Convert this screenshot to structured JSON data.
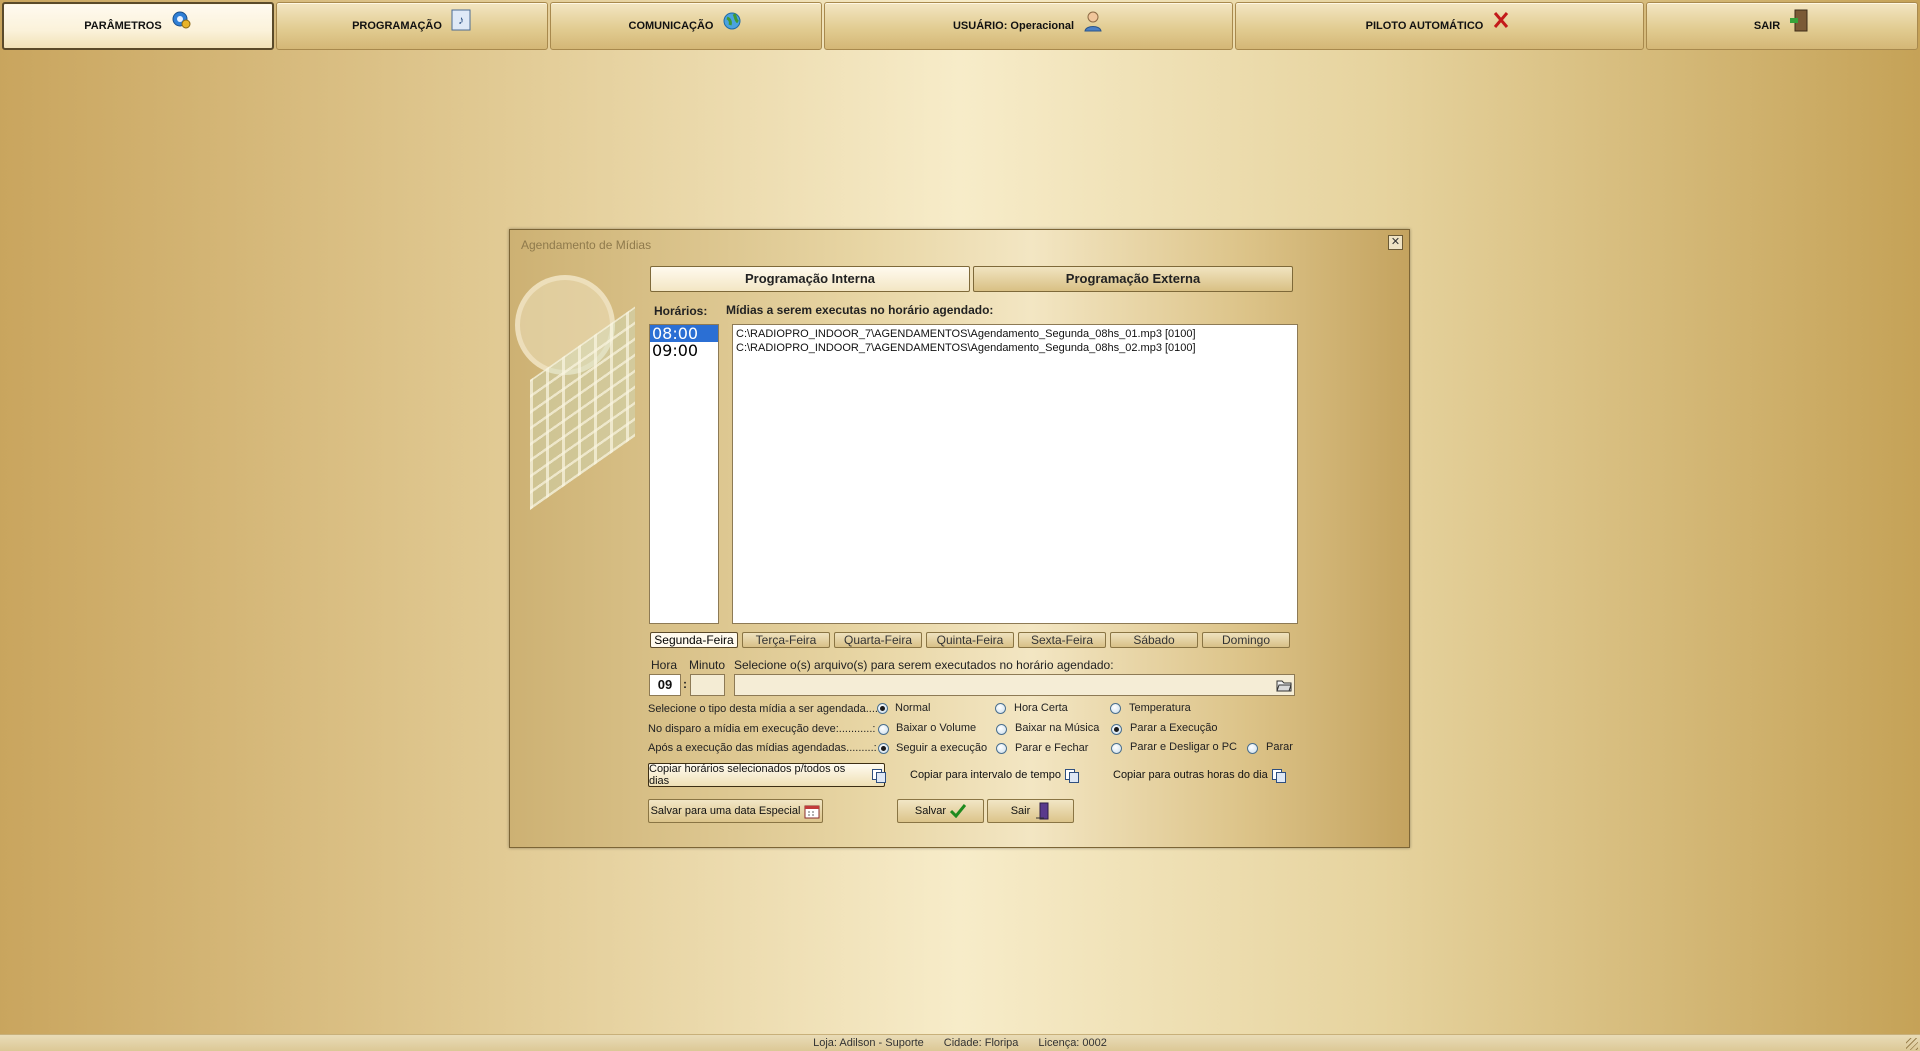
{
  "topmenu": {
    "parametros": "PARÂMETROS",
    "programacao": "PROGRAMAÇÃO",
    "comunicacao": "COMUNICAÇÃO",
    "usuario": "USUÁRIO: Operacional",
    "piloto": "PILOTO AUTOMÁTICO",
    "sair": "SAIR"
  },
  "dialog": {
    "title": "Agendamento de Mídias",
    "close_symbol": "✕",
    "tabs": {
      "interna": "Programação Interna",
      "externa": "Programação Externa"
    },
    "horarios_label": "Horários:",
    "midias_label": "Mídias a serem executas no horário agendado:",
    "hours": [
      "08:00",
      "09:00"
    ],
    "media": [
      "C:\\RADIOPRO_INDOOR_7\\AGENDAMENTOS\\Agendamento_Segunda_08hs_01.mp3 [0100]",
      "C:\\RADIOPRO_INDOOR_7\\AGENDAMENTOS\\Agendamento_Segunda_08hs_02.mp3 [0100]"
    ],
    "days": [
      "Segunda-Feira",
      "Terça-Feira",
      "Quarta-Feira",
      "Quinta-Feira",
      "Sexta-Feira",
      "Sábado",
      "Domingo"
    ],
    "hora_label": "Hora",
    "minuto_label": "Minuto",
    "hora_value": "09",
    "minuto_value": "",
    "time_sep": ":",
    "file_label": "Selecione o(s) arquivo(s) para serem executados no horário agendado:",
    "file_value": "",
    "row1_label": "Selecione o tipo desta mídia a ser agendada....:",
    "row1_opts": [
      "Normal",
      "Hora Certa",
      "Temperatura"
    ],
    "row2_label": "No disparo a mídia em execução deve:...........:",
    "row2_opts": [
      "Baixar o Volume",
      "Baixar na Música",
      "Parar a Execução"
    ],
    "row3_label": "Após a execução das mídias agendadas.........:",
    "row3_opts": [
      "Seguir a execução",
      "Parar e Fechar",
      "Parar e Desligar o PC",
      "Parar"
    ],
    "copy_all_days": "Copiar horários selecionados p/todos os dias",
    "copy_interval": "Copiar para intervalo de tempo",
    "copy_other_hours": "Copiar para outras horas do dia",
    "save_special": "Salvar para uma data Especial",
    "save": "Salvar",
    "exit": "Sair"
  },
  "status": {
    "loja": "Loja: Adilson - Suporte",
    "cidade": "Cidade: Floripa",
    "licenca": "Licença: 0002"
  }
}
